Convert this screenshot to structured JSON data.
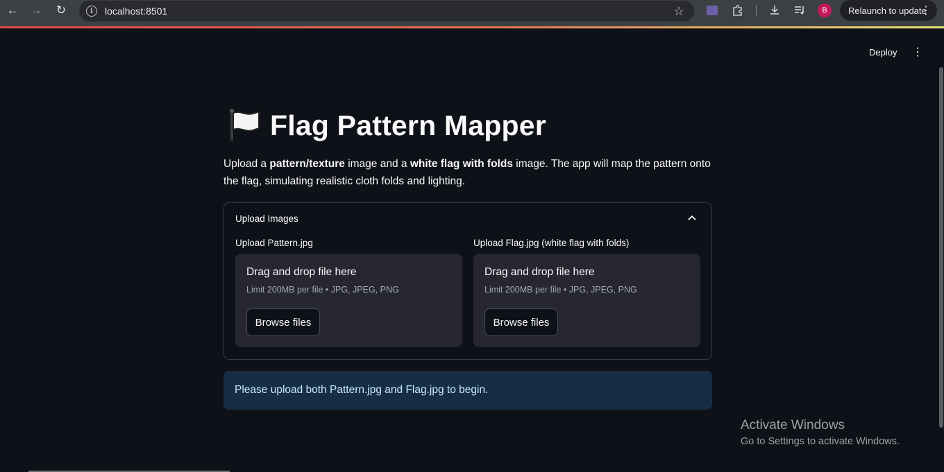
{
  "browser": {
    "url": "localhost:8501",
    "relaunch_label": "Relaunch to update",
    "avatar_letter": "B"
  },
  "app_header": {
    "deploy_label": "Deploy"
  },
  "main": {
    "title": "Flag Pattern Mapper",
    "description": {
      "part1": "Upload a ",
      "bold1": "pattern/texture",
      "part2": " image and a ",
      "bold2": "white flag with folds",
      "part3": " image. The app will map the pattern onto the flag, simulating realistic cloth folds and lighting."
    },
    "expander": {
      "label": "Upload Images",
      "uploaders": [
        {
          "label": "Upload Pattern.jpg",
          "drop_text": "Drag and drop file here",
          "limit_text": "Limit 200MB per file • JPG, JPEG, PNG",
          "button_label": "Browse files"
        },
        {
          "label": "Upload Flag.jpg (white flag with folds)",
          "drop_text": "Drag and drop file here",
          "limit_text": "Limit 200MB per file • JPG, JPEG, PNG",
          "button_label": "Browse files"
        }
      ]
    },
    "info_message": "Please upload both Pattern.jpg and Flag.jpg to begin."
  },
  "watermark": {
    "line1": "Activate Windows",
    "line2": "Go to Settings to activate Windows."
  },
  "colors": {
    "background": "#0e1117",
    "card": "#262730",
    "info_bg": "#172d43",
    "info_text": "#c7ebff"
  }
}
